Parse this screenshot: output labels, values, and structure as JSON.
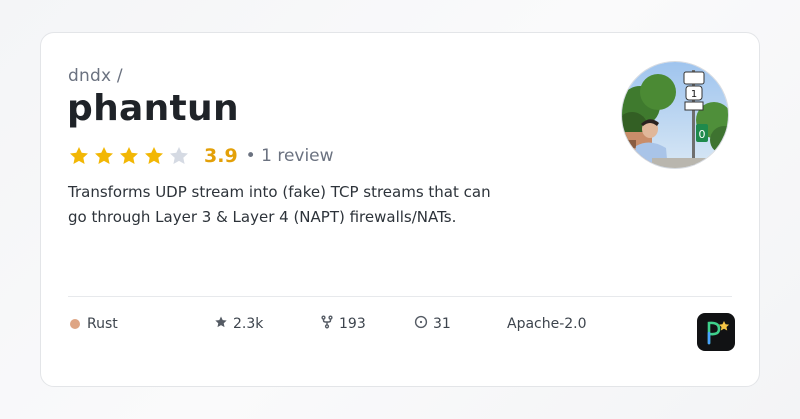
{
  "repo": {
    "owner": "dndx /",
    "name": "phantun",
    "rating": 3.9,
    "rating_label": "3.9",
    "stars_filled": 4,
    "stars_total": 5,
    "review_count": "• 1 review",
    "description": "Transforms UDP stream into (fake) TCP streams that can go through Layer 3 & Layer 4 (NAPT) firewalls/NATs."
  },
  "stats": {
    "language": "Rust",
    "language_color": "#dea584",
    "stars": "2.3k",
    "forks": "193",
    "issues": "31",
    "license": "Apache-2.0"
  },
  "colors": {
    "star_filled": "#f2b705",
    "star_empty": "#d5dae3",
    "rating_text": "#e3a008"
  },
  "icons": {
    "star": "star-icon",
    "fork": "fork-icon",
    "issue": "issue-icon",
    "app": "app-logo-icon"
  }
}
